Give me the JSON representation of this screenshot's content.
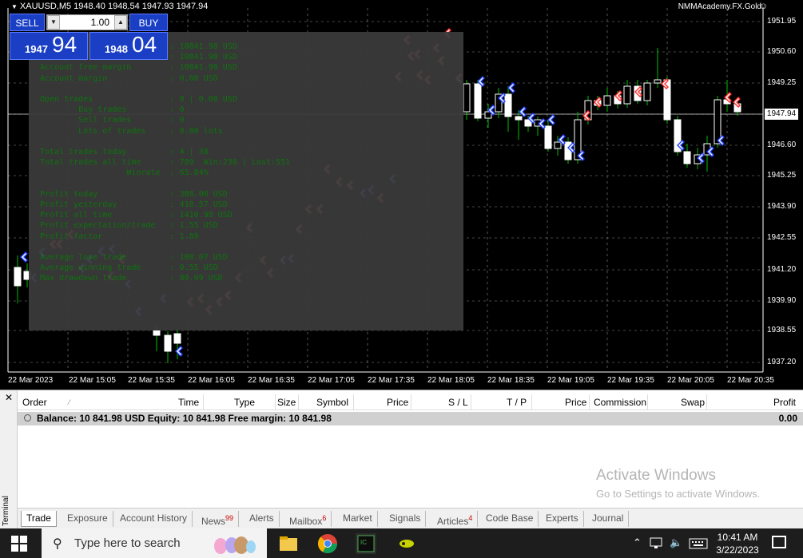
{
  "chart": {
    "title": "XAUUSD,M5  1948.40 1948.54 1947.93 1947.94",
    "broker": "NMMAcademy.FX.Gold",
    "current_price": "1947.94",
    "price_labels": [
      "1951.95",
      "1950.60",
      "1949.25",
      "1946.60",
      "1945.25",
      "1943.90",
      "1942.55",
      "1941.20",
      "1939.90",
      "1938.55",
      "1937.20"
    ],
    "time_labels": [
      "22 Mar 2023",
      "22 Mar 15:05",
      "22 Mar 15:35",
      "22 Mar 16:05",
      "22 Mar 16:35",
      "22 Mar 17:05",
      "22 Mar 17:35",
      "22 Mar 18:05",
      "22 Mar 18:35",
      "22 Mar 19:05",
      "22 Mar 19:35",
      "22 Mar 20:05",
      "22 Mar 20:35"
    ],
    "colors": {
      "background": "#000000",
      "grid": "#ffffff",
      "bull": "#ffffff",
      "bear": "#ffffff",
      "buy_arrow": "#1f3fff",
      "sell_arrow": "#ff2a2a",
      "ea_text": "#0f7a0f"
    }
  },
  "one_click": {
    "sell_label": "SELL",
    "buy_label": "BUY",
    "volume": "1.00",
    "sell_small": "1947",
    "sell_big": "94",
    "buy_small": "1948",
    "buy_big": "04"
  },
  "ea_panel": {
    "lines": [
      "Balance                    : 10841.98 USD",
      "Equity                     : 10841.98 USD",
      "Account free margin        : 10841.98 USD",
      "Account margin             : 0.00 USD",
      "",
      "Open trades                : 0 | 0.00 USD",
      "        Buy trades         : 0",
      "        Sell trades        : 0",
      "        Lots of trades     : 0.00 lots",
      "",
      "Total trades today         : 4 | 38",
      "Total trades all time      : 789  Win:238 | Lost:551",
      "                  Winrate  : 65.84%",
      "",
      "Profit today               : 388.00 USD",
      "Profit yesterday           : 410.57 USD",
      "Profit all time            : 1410.98 USD",
      "Profit expectation/trade   : 1.55 USD",
      "Profit factor              : 1.89",
      "",
      "Average lose trade         : 108.07 USD",
      "Average winning trade      : 0.55 USD",
      "Max drawdown trade         : 80.09 USD"
    ]
  },
  "terminal": {
    "side_label": "Terminal",
    "columns": [
      "Order",
      "Time",
      "Type",
      "Size",
      "Symbol",
      "Price",
      "S / L",
      "T / P",
      "Price",
      "Commission",
      "Swap",
      "Profit"
    ],
    "balance_text": "Balance: 10 841.98 USD  Equity: 10 841.98  Free margin: 10 841.98",
    "profit": "0.00",
    "activate_title": "Activate Windows",
    "activate_sub": "Go to Settings to activate Windows.",
    "tabs": [
      {
        "label": "Trade",
        "badge": ""
      },
      {
        "label": "Exposure",
        "badge": ""
      },
      {
        "label": "Account History",
        "badge": ""
      },
      {
        "label": "News",
        "badge": "99"
      },
      {
        "label": "Alerts",
        "badge": ""
      },
      {
        "label": "Mailbox",
        "badge": "6"
      },
      {
        "label": "Market",
        "badge": ""
      },
      {
        "label": "Signals",
        "badge": ""
      },
      {
        "label": "Articles",
        "badge": "4"
      },
      {
        "label": "Code Base",
        "badge": ""
      },
      {
        "label": "Experts",
        "badge": ""
      },
      {
        "label": "Journal",
        "badge": ""
      }
    ]
  },
  "taskbar": {
    "search_placeholder": "Type here to search",
    "time": "10:41 AM",
    "date": "3/22/2023",
    "icons": [
      "windows-icon",
      "search-icon",
      "easter-eggs-icon",
      "file-explorer-icon",
      "chrome-icon",
      "metatrader-icon",
      "app-icon",
      "chevron-up-icon",
      "network-icon",
      "volume-icon",
      "keyboard-icon",
      "notification-icon"
    ]
  }
}
